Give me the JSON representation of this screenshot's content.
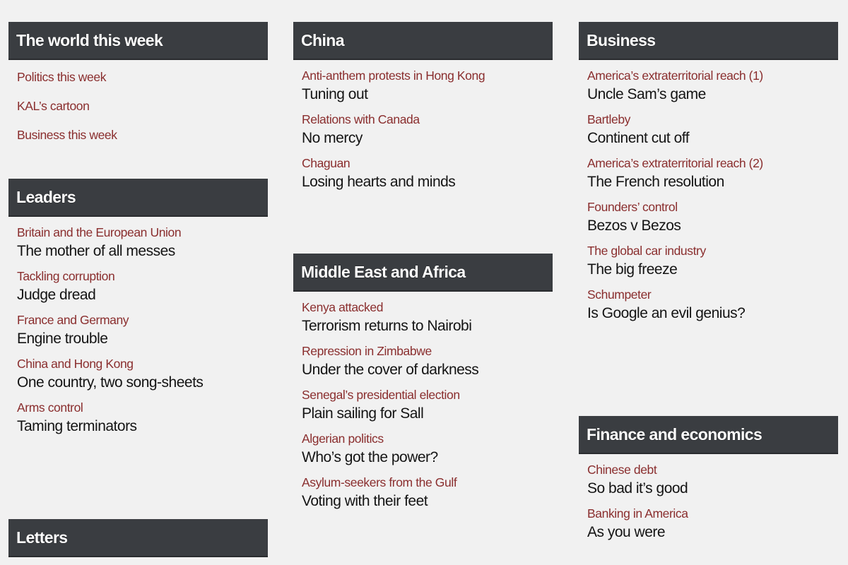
{
  "columns": [
    {
      "sections": [
        {
          "title": "The world this week",
          "links": [
            "Politics this week",
            "KAL’s cartoon",
            "Business this week"
          ]
        },
        {
          "title": "Leaders",
          "items": [
            {
              "kicker": "Britain and the European Union",
              "headline": "The mother of all messes"
            },
            {
              "kicker": "Tackling corruption",
              "headline": "Judge dread"
            },
            {
              "kicker": "France and Germany",
              "headline": "Engine trouble"
            },
            {
              "kicker": "China and Hong Kong",
              "headline": "One country, two song-sheets"
            },
            {
              "kicker": "Arms control",
              "headline": "Taming terminators"
            }
          ]
        },
        {
          "title": "Letters",
          "items": []
        }
      ]
    },
    {
      "sections": [
        {
          "title": "China",
          "items": [
            {
              "kicker": "Anti-anthem protests in Hong Kong",
              "headline": "Tuning out"
            },
            {
              "kicker": "Relations with Canada",
              "headline": "No mercy"
            },
            {
              "kicker": "Chaguan",
              "headline": "Losing hearts and minds"
            }
          ]
        },
        {
          "title": "Middle East and Africa",
          "items": [
            {
              "kicker": "Kenya attacked",
              "headline": "Terrorism returns to Nairobi"
            },
            {
              "kicker": "Repression in Zimbabwe",
              "headline": "Under the cover of darkness"
            },
            {
              "kicker": "Senegal’s presidential election",
              "headline": "Plain sailing for Sall"
            },
            {
              "kicker": "Algerian politics",
              "headline": "Who’s got the power?"
            },
            {
              "kicker": "Asylum-seekers from the Gulf",
              "headline": "Voting with their feet"
            }
          ]
        }
      ]
    },
    {
      "sections": [
        {
          "title": "Business",
          "items": [
            {
              "kicker": "America’s extraterritorial reach (1)",
              "headline": "Uncle Sam’s game"
            },
            {
              "kicker": "Bartleby",
              "headline": "Continent cut off"
            },
            {
              "kicker": "America’s extraterritorial reach (2)",
              "headline": "The French resolution"
            },
            {
              "kicker": "Founders’ control",
              "headline": "Bezos v Bezos"
            },
            {
              "kicker": "The global car industry",
              "headline": "The big freeze"
            },
            {
              "kicker": "Schumpeter",
              "headline": "Is Google an evil genius?"
            }
          ]
        },
        {
          "title": "Finance and economics",
          "items": [
            {
              "kicker": "Chinese debt",
              "headline": "So bad it’s good"
            },
            {
              "kicker": "Banking in America",
              "headline": "As you were"
            }
          ]
        }
      ]
    }
  ],
  "colors": {
    "background": "#f1f1f1",
    "header_bg": "#3a3d41",
    "kicker": "#8a2e2e",
    "headline": "#141414"
  }
}
